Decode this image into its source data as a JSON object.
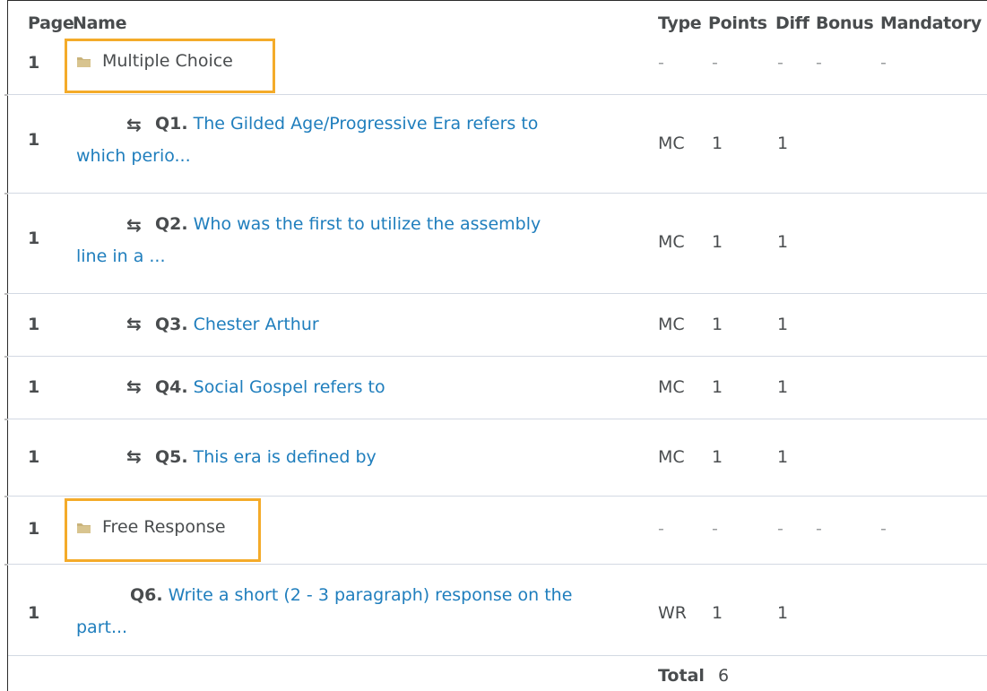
{
  "headers": {
    "page": "Page",
    "name": "Name",
    "type": "Type",
    "points": "Points",
    "diff": "Diff",
    "bonus": "Bonus",
    "mandatory": "Mandatory"
  },
  "dash": "-",
  "sections": [
    {
      "page": "1",
      "title": "Multiple Choice"
    },
    {
      "page": "1",
      "title": "Free Response"
    }
  ],
  "questions": [
    {
      "page": "1",
      "num": "Q1.",
      "line1": "The Gilded Age/Progressive Era refers to",
      "line2": "which perio...",
      "type": "MC",
      "points": "1",
      "diff": "1"
    },
    {
      "page": "1",
      "num": "Q2.",
      "line1": "Who was the first to utilize the assembly",
      "line2": "line in a ...",
      "type": "MC",
      "points": "1",
      "diff": "1"
    },
    {
      "page": "1",
      "num": "Q3.",
      "line1": "Chester Arthur",
      "type": "MC",
      "points": "1",
      "diff": "1"
    },
    {
      "page": "1",
      "num": "Q4.",
      "line1": "Social Gospel refers to",
      "type": "MC",
      "points": "1",
      "diff": "1"
    },
    {
      "page": "1",
      "num": "Q5.",
      "line1": "This era is defined by",
      "type": "MC",
      "points": "1",
      "diff": "1"
    },
    {
      "page": "1",
      "num": "Q6.",
      "line1": "Write a short (2 - 3 paragraph) response on the",
      "line2": "part...",
      "type": "WR",
      "points": "1",
      "diff": "1"
    }
  ],
  "footer": {
    "total_label": "Total",
    "total_value": "6"
  },
  "icons": {
    "folder": "folder-icon",
    "branch": "branching-question-icon"
  },
  "colors": {
    "link": "#1f7ebd",
    "highlight": "#f4ab2a",
    "folder": "#c9b37a",
    "divider": "#d3d9e3"
  }
}
